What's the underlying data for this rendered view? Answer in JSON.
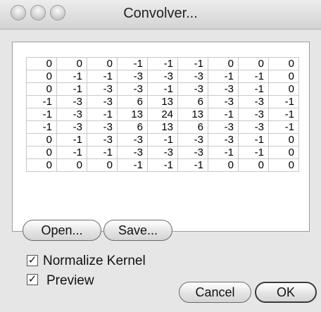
{
  "window": {
    "title": "Convolver..."
  },
  "kernel": {
    "rows": [
      [
        "0",
        "0",
        "0",
        "-1",
        "-1",
        "-1",
        "0",
        "0",
        "0"
      ],
      [
        "0",
        "-1",
        "-1",
        "-3",
        "-3",
        "-3",
        "-1",
        "-1",
        "0"
      ],
      [
        "0",
        "-1",
        "-3",
        "-3",
        "-1",
        "-3",
        "-3",
        "-1",
        "0"
      ],
      [
        "-1",
        "-3",
        "-3",
        "6",
        "13",
        "6",
        "-3",
        "-3",
        "-1"
      ],
      [
        "-1",
        "-3",
        "-1",
        "13",
        "24",
        "13",
        "-1",
        "-3",
        "-1"
      ],
      [
        "-1",
        "-3",
        "-3",
        "6",
        "13",
        "6",
        "-3",
        "-3",
        "-1"
      ],
      [
        "0",
        "-1",
        "-3",
        "-3",
        "-1",
        "-3",
        "-3",
        "-1",
        "0"
      ],
      [
        "0",
        "-1",
        "-1",
        "-3",
        "-3",
        "-3",
        "-1",
        "-1",
        "0"
      ],
      [
        "0",
        "0",
        "0",
        "-1",
        "-1",
        "-1",
        "0",
        "0",
        "0"
      ]
    ]
  },
  "buttons": {
    "open": "Open...",
    "save": "Save...",
    "cancel": "Cancel",
    "ok": "OK"
  },
  "options": {
    "normalize_label": "Normalize Kernel",
    "normalize_checked": true,
    "preview_label": "Preview",
    "preview_checked": true
  },
  "icons": {
    "checkbox_mark": "✓",
    "window_controls": [
      "close-icon",
      "minimize-icon",
      "zoom-icon"
    ]
  }
}
